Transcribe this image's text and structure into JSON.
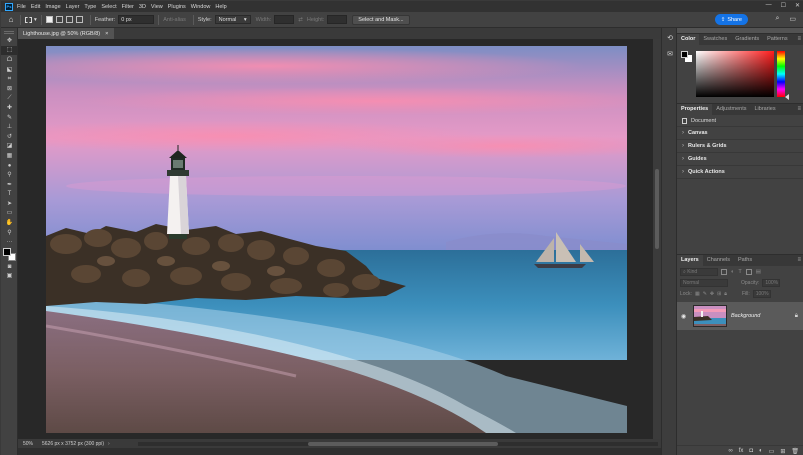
{
  "app": {
    "logo": "Ps"
  },
  "menu": [
    "File",
    "Edit",
    "Image",
    "Layer",
    "Type",
    "Select",
    "Filter",
    "3D",
    "View",
    "Plugins",
    "Window",
    "Help"
  ],
  "window_controls": {
    "minimize": "—",
    "maximize": "☐",
    "close": "✕"
  },
  "options_bar": {
    "feather_label": "Feather:",
    "feather_value": "0 px",
    "anti_alias_label": "Anti-alias",
    "style_label": "Style:",
    "style_value": "Normal",
    "width_label": "Width:",
    "height_label": "Height:",
    "select_mask_label": "Select and Mask...",
    "share_label": "Share"
  },
  "document": {
    "tab_title": "Lighthouse.jpg @ 50% (RGB/8)",
    "close": "×"
  },
  "status": {
    "zoom": "50%",
    "info": "5626 px x 3752 px (300 ppi)",
    "arrow": "›"
  },
  "color_panel": {
    "tabs": [
      "Color",
      "Swatches",
      "Gradients",
      "Patterns"
    ],
    "foreground": "#000000",
    "background": "#ffffff"
  },
  "properties_panel": {
    "tabs": [
      "Properties",
      "Adjustments",
      "Libraries"
    ],
    "document_label": "Document",
    "sections": [
      "Canvas",
      "Rulers & Grids",
      "Guides",
      "Quick Actions"
    ]
  },
  "layers_panel": {
    "tabs": [
      "Layers",
      "Channels",
      "Paths"
    ],
    "filter_placeholder": "Kind",
    "blend_mode": "Normal",
    "opacity_label": "Opacity:",
    "opacity_value": "100%",
    "lock_label": "Lock:",
    "fill_label": "Fill:",
    "fill_value": "100%",
    "layers": [
      {
        "name": "Background",
        "visible": true,
        "locked": true
      }
    ]
  },
  "colors": {
    "accent": "#1473e6",
    "chrome_dark": "#323232",
    "panel": "#424242",
    "workspace": "#282828"
  }
}
